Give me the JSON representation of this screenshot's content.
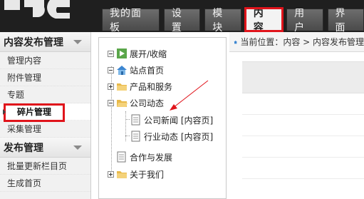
{
  "logo_text": "IPC",
  "nav": {
    "tabs": [
      {
        "label": "我的面板"
      },
      {
        "label": "设置"
      },
      {
        "label": "模块"
      },
      {
        "label": "内容"
      },
      {
        "label": "用户"
      },
      {
        "label": "界面"
      }
    ],
    "active_index": 3
  },
  "sidebar": {
    "sections": [
      {
        "title": "内容发布管理",
        "items": [
          "管理内容",
          "附件管理",
          "专题",
          "碎片管理",
          "采集管理"
        ]
      },
      {
        "title": "发布管理",
        "items": [
          "批量更新栏目页",
          "生成首页"
        ]
      }
    ],
    "active_item": "碎片管理"
  },
  "tree": {
    "toggle_label": "展开/收缩",
    "nodes": [
      {
        "label": "站点首页"
      },
      {
        "label": "产品和服务"
      },
      {
        "label": "公司动态"
      },
      {
        "label": "公司新闻 [内容页]"
      },
      {
        "label": "行业动态 [内容页]"
      },
      {
        "label": "合作与发展"
      },
      {
        "label": "关于我们"
      }
    ]
  },
  "breadcrumb": "当前位置：内容 > 内容发布管理",
  "colors": {
    "highlight": "#e0141b",
    "topbar": "#1f1f1f",
    "folder": "#e8b94a"
  },
  "icons": [
    "home-icon",
    "folder-icon",
    "page-icon",
    "refresh-icon"
  ]
}
